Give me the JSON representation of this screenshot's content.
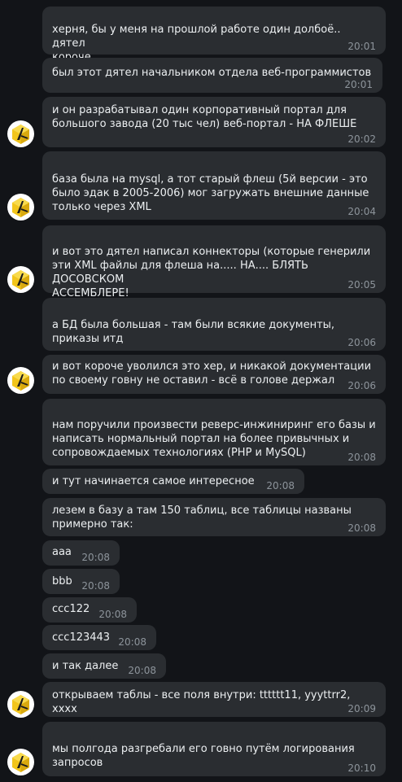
{
  "messages": [
    {
      "text": "херня, бы у меня на прошлой работе один долбоё.. дятел\nкороче",
      "time": "20:01"
    },
    {
      "text": "был этот дятел начальником отдела веб-программистов",
      "time": "20:01"
    },
    {
      "text": "и он разрабатывал один корпоративный портал для\nбольшого завода (20 тыс чел) веб-портал - НА ФЛЕШЕ",
      "time": "20:02"
    },
    {
      "text": "база была на mysql, а тот старый флеш (5й версии - это\nбыло эдак в 2005-2006) мог загружать внешние данные\nтолько через XML",
      "time": "20:04"
    },
    {
      "text": "и вот это дятел написал коннекторы (которые генерили\nэти XML файлы для флеша на..... НА.... БЛЯТЬ ДОСОВСКОМ\nАССЕМБЛЕРЕ!",
      "time": "20:05"
    },
    {
      "text": "а БД была большая - там были всякие документы,\nприказы итд",
      "time": "20:06"
    },
    {
      "text": "и вот короче уволился это хер, и никакой документации\nпо своему говну не оставил - всё в голове держал",
      "time": "20:06"
    },
    {
      "text": "нам поручили произвести реверс-инжиниринг его базы и\nнаписать нормальный портал на более привычных и\nсопровождаемых технологиях (PHP и MySQL)",
      "time": "20:08"
    },
    {
      "text": "и тут начинается самое интересное",
      "time": "20:08"
    },
    {
      "text": "лезем в базу а там 150 таблиц, все таблицы названы\nпримерно так:",
      "time": "20:08"
    },
    {
      "text": "aaa",
      "time": "20:08"
    },
    {
      "text": "bbb",
      "time": "20:08"
    },
    {
      "text": "ccc122",
      "time": "20:08"
    },
    {
      "text": "ccc123443",
      "time": "20:08"
    },
    {
      "text": "и так далее",
      "time": "20:08"
    },
    {
      "text": "открываем таблы - все поля внутри: tttttt11, yyyttrr2, xxxx",
      "time": "20:09"
    },
    {
      "text": "мы полгода разгребали его говно путём логирования\nзапросов",
      "time": "20:10"
    }
  ],
  "avatar": {
    "icon": "yellow-cube-avatar-icon"
  }
}
